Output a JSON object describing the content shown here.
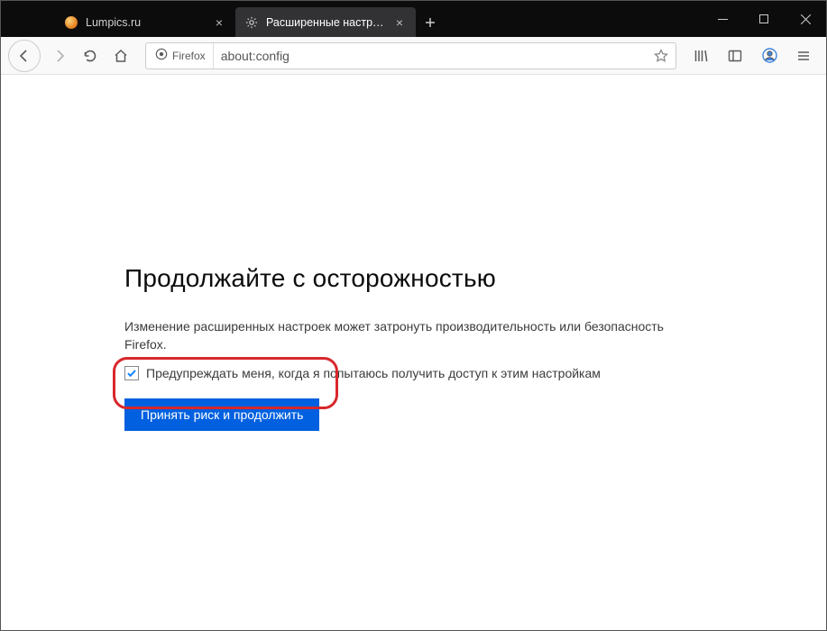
{
  "titlebar": {
    "tabs": [
      {
        "label": "Lumpics.ru",
        "active": false
      },
      {
        "label": "Расширенные настройки",
        "active": true
      }
    ],
    "newtab_title": "New Tab"
  },
  "toolbar": {
    "identity_label": "Firefox",
    "url": "about:config"
  },
  "content": {
    "heading": "Продолжайте с осторожностью",
    "description": "Изменение расширенных настроек может затронуть производительность или безопасность Firefox.",
    "checkbox_label": "Предупреждать меня, когда я попытаюсь получить доступ к этим настройкам",
    "checkbox_checked": true,
    "accept_label": "Принять риск и продолжить"
  }
}
